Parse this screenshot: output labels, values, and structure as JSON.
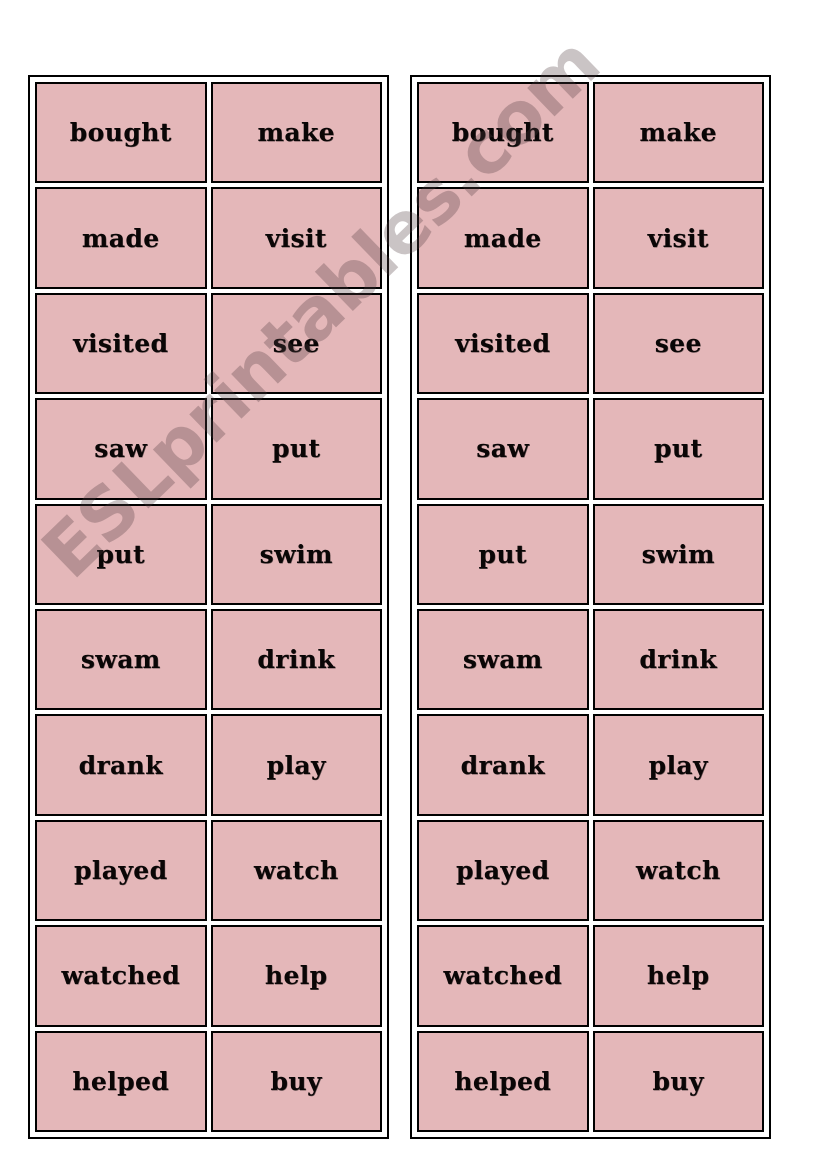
{
  "page": {
    "title": "Irregular past tense verb cards",
    "background_color": "#ffffff",
    "card_color": "#e4b7b9",
    "border_color": "#000000",
    "text_color": "#0a0606"
  },
  "watermark": {
    "text": "ESLprintables.com",
    "color": "rgba(80, 60, 62, 0.30)",
    "rotation_deg": -44
  },
  "tables": [
    {
      "name": "left-card-table",
      "columns": 2,
      "rows": [
        {
          "left": "bought",
          "right": "make"
        },
        {
          "left": "made",
          "right": "visit"
        },
        {
          "left": "visited",
          "right": "see"
        },
        {
          "left": "saw",
          "right": "put"
        },
        {
          "left": "put",
          "right": "swim"
        },
        {
          "left": "swam",
          "right": "drink"
        },
        {
          "left": "drank",
          "right": "play"
        },
        {
          "left": "played",
          "right": "watch"
        },
        {
          "left": "watched",
          "right": "help"
        },
        {
          "left": "helped",
          "right": "buy"
        }
      ]
    },
    {
      "name": "right-card-table",
      "columns": 2,
      "rows": [
        {
          "left": "bought",
          "right": "make"
        },
        {
          "left": "made",
          "right": "visit"
        },
        {
          "left": "visited",
          "right": "see"
        },
        {
          "left": "saw",
          "right": "put"
        },
        {
          "left": "put",
          "right": "swim"
        },
        {
          "left": "swam",
          "right": "drink"
        },
        {
          "left": "drank",
          "right": "play"
        },
        {
          "left": "played",
          "right": "watch"
        },
        {
          "left": "watched",
          "right": "help"
        },
        {
          "left": "helped",
          "right": "buy"
        }
      ]
    }
  ]
}
